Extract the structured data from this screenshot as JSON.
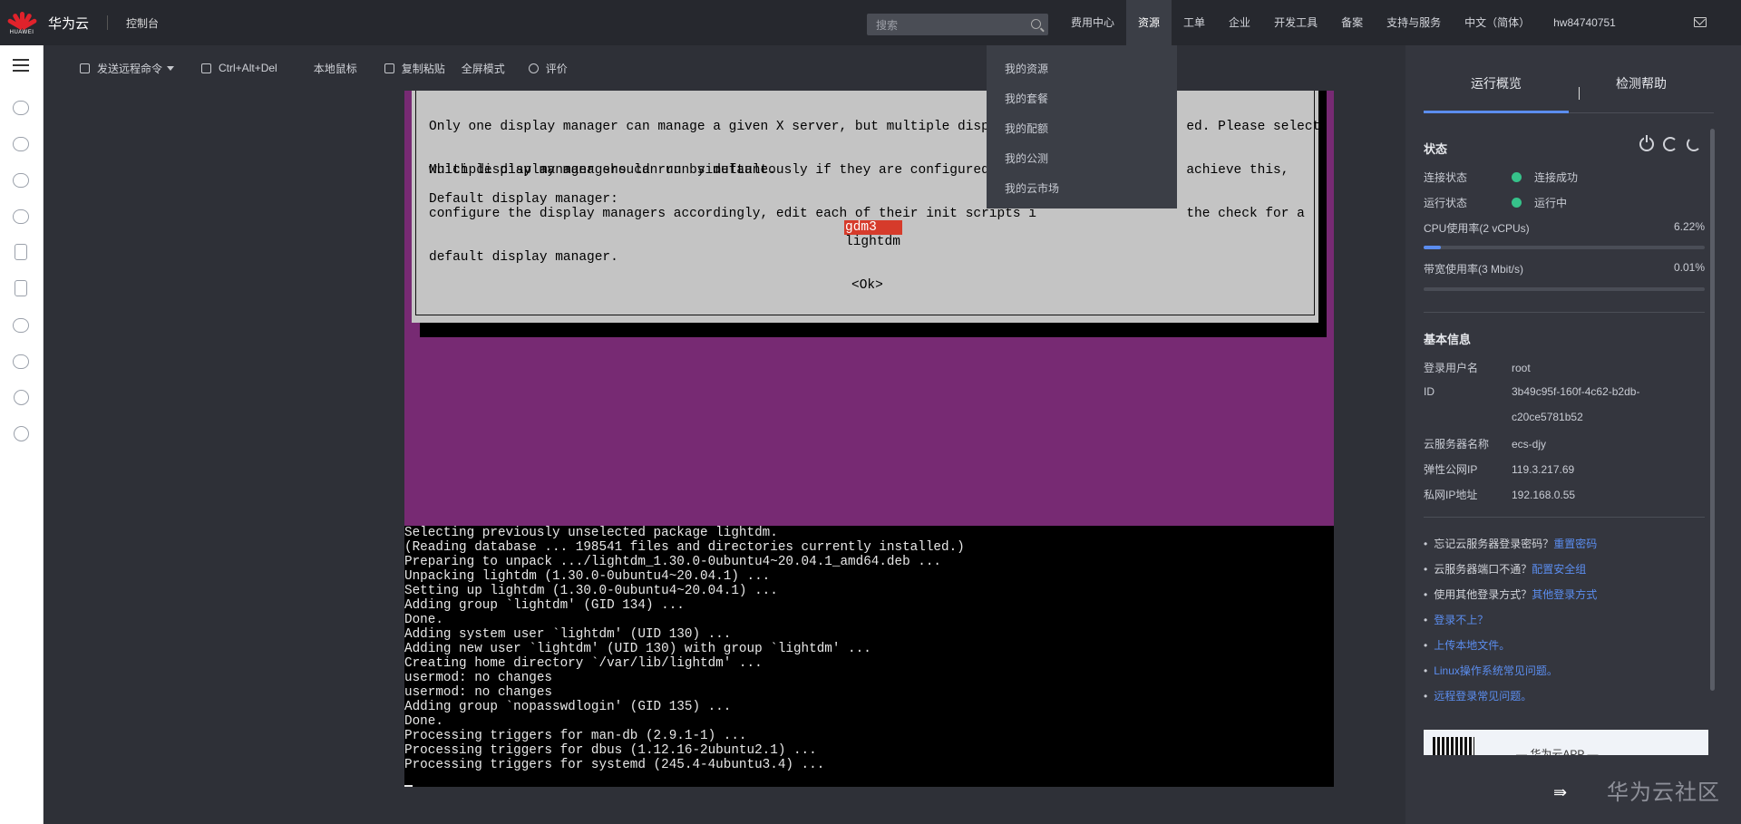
{
  "topbar": {
    "logo_word": "HUAWEI",
    "brand": "华为云",
    "console": "控制台",
    "search_placeholder": "搜索",
    "nav": [
      "费用中心",
      "资源",
      "工单",
      "企业",
      "开发工具",
      "备案",
      "支持与服务",
      "中文（简体）",
      "hw84740751"
    ],
    "active_nav": "资源"
  },
  "dropdown": {
    "items": [
      "我的资源",
      "我的套餐",
      "我的配额",
      "我的公测",
      "我的云市场"
    ]
  },
  "toolbar": {
    "send_remote_command": "发送远程命令",
    "ctrl_alt_del": "Ctrl+Alt+Del",
    "local_mouse": "本地鼠标",
    "copy_paste": "复制粘贴",
    "fullscreen": "全屏模式",
    "rate": "评价"
  },
  "remote_screen": {
    "dialog_lines_1": [
      "Only one display manager can manage a given X server, but multiple display ma                   ed. Please select",
      "which display manager should run by default."
    ],
    "dialog_lines_2": [
      "Multiple display managers can run simultaneously if they are configured to ma                   achieve this,",
      "configure the display managers accordingly, edit each of their init scripts i                   the check for a",
      "default display manager."
    ],
    "dialog_prompt": "Default display manager:",
    "selected_option": "gdm3",
    "other_option": "lightdm",
    "ok_button": "<Ok>",
    "terminal_lines": [
      "Selecting previously unselected package lightdm.",
      "(Reading database ... 198541 files and directories currently installed.)",
      "Preparing to unpack .../lightdm_1.30.0-0ubuntu4~20.04.1_amd64.deb ...",
      "Unpacking lightdm (1.30.0-0ubuntu4~20.04.1) ...",
      "Setting up lightdm (1.30.0-0ubuntu4~20.04.1) ...",
      "Adding group `lightdm' (GID 134) ...",
      "Done.",
      "Adding system user `lightdm' (UID 130) ...",
      "Adding new user `lightdm' (UID 130) with group `lightdm' ...",
      "Creating home directory `/var/lib/lightdm' ...",
      "usermod: no changes",
      "usermod: no changes",
      "Adding group `nopasswdlogin' (GID 135) ...",
      "Done.",
      "Processing triggers for man-db (2.9.1-1) ...",
      "Processing triggers for dbus (1.12.16-2ubuntu2.1) ...",
      "Processing triggers for systemd (245.4-4ubuntu3.4) ..."
    ]
  },
  "panel": {
    "tabs": [
      "运行概览",
      "检测帮助"
    ],
    "status_title": "状态",
    "connection_label": "连接状态",
    "connection_value": "连接成功",
    "running_label": "运行状态",
    "running_value": "运行中",
    "cpu_label": "CPU使用率(2 vCPUs)",
    "cpu_value": "6.22%",
    "cpu_fraction": 0.0622,
    "bandwidth_label": "带宽使用率(3 Mbit/s)",
    "bandwidth_value": "0.01%",
    "bandwidth_fraction": 0.0001,
    "basic_info_title": "基本信息",
    "info": [
      {
        "label": "登录用户名",
        "value": "root"
      },
      {
        "label": "ID",
        "value": "3b49c95f-160f-4c62-b2db-"
      },
      {
        "label": "",
        "value": "c20ce5781b52"
      },
      {
        "label": "云服务器名称",
        "value": "ecs-djy"
      },
      {
        "label": "弹性公网IP",
        "value": "119.3.217.69"
      },
      {
        "label": "私网IP地址",
        "value": "192.168.0.55"
      }
    ],
    "help": [
      {
        "text": "忘记云服务器登录密码？",
        "link": "重置密码"
      },
      {
        "text": "云服务器端口不通？",
        "link": "配置安全组"
      },
      {
        "text": "使用其他登录方式？",
        "link": "其他登录方式"
      },
      {
        "text": "",
        "link": "登录不上？"
      },
      {
        "text": "",
        "link": "上传本地文件。"
      },
      {
        "text": "",
        "link": "Linux操作系统常见问题。"
      },
      {
        "text": "",
        "link": "远程登录常见问题。"
      }
    ],
    "banner_text": "— 华为云APP —",
    "watermark": "华为云社区"
  },
  "colors": {
    "accent": "#5b8def",
    "status_green": "#36c28a",
    "desktop_purple": "#772a73",
    "selection_red": "#d63b2b"
  }
}
